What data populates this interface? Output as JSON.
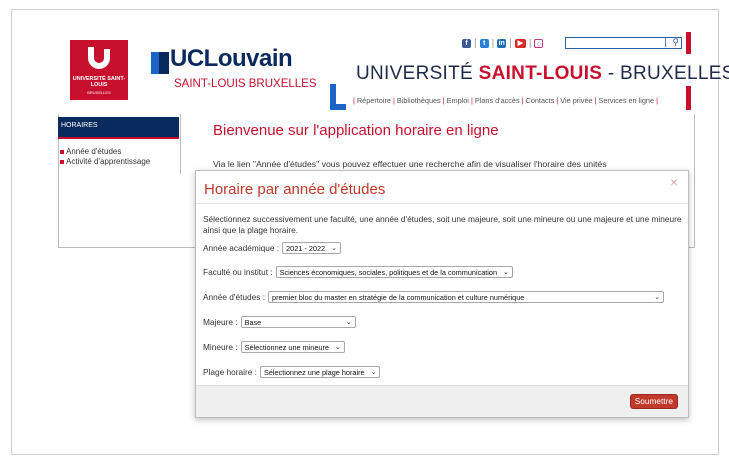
{
  "logo": {
    "red_line1": "UNIVERSITÉ SAINT-LOUIS",
    "red_line2": "BRUXELLES",
    "ucl_name": "UCLouvain",
    "ucl_sub": "SAINT-LOUIS BRUXELLES"
  },
  "header": {
    "title_part1": "UNIVERSITÉ ",
    "title_part2": "SAINT-LOUIS",
    "title_part3": " - BRUXELLES",
    "social_icons": [
      "facebook-icon",
      "twitter-icon",
      "linkedin-icon",
      "youtube-icon",
      "instagram-icon"
    ],
    "search_placeholder": ""
  },
  "nav": {
    "links": [
      "Répertoire",
      "Bibliothèques",
      "Emploi",
      "Plans d'accès",
      "Contacts",
      "Vie privée",
      "Services en ligne"
    ]
  },
  "sidebar": {
    "heading": "HORAIRES",
    "items": [
      {
        "label": "Année d'études"
      },
      {
        "label": "Activité d'apprentissage"
      }
    ]
  },
  "main": {
    "welcome": "Bienvenue sur l'application horaire en ligne",
    "intro": "Via le lien \"Année d'études\" vous pouvez effectuer une recherche afin de visualiser l'horaire des unités"
  },
  "modal": {
    "title": "Horaire par année d'études",
    "description": "Sélectionnez successivement une faculté, une année d'études, soit une majeure, soit une mineure ou une majeure et une mineure ainsi que la plage horaire.",
    "fields": {
      "academic_year": {
        "label": "Année académique :",
        "value": "2021 - 2022"
      },
      "faculty": {
        "label": "Faculté ou institut :",
        "value": "Sciences économiques, sociales, politiques et de la communication"
      },
      "study_year": {
        "label": "Année d'études :",
        "value": "premier bloc du master en stratégie de la communication et culture numérique"
      },
      "major": {
        "label": "Majeure :",
        "value": "Base"
      },
      "minor": {
        "label": "Mineure :",
        "value": "Sélectionnez une mineure"
      },
      "time_range": {
        "label": "Plage horaire :",
        "value": "Sélectionnez une plage horaire"
      }
    },
    "submit_label": "Soumettre"
  },
  "colors": {
    "brand_red": "#c8102e",
    "brand_navy": "#0a2a5e",
    "brand_blue": "#1e64c8"
  }
}
